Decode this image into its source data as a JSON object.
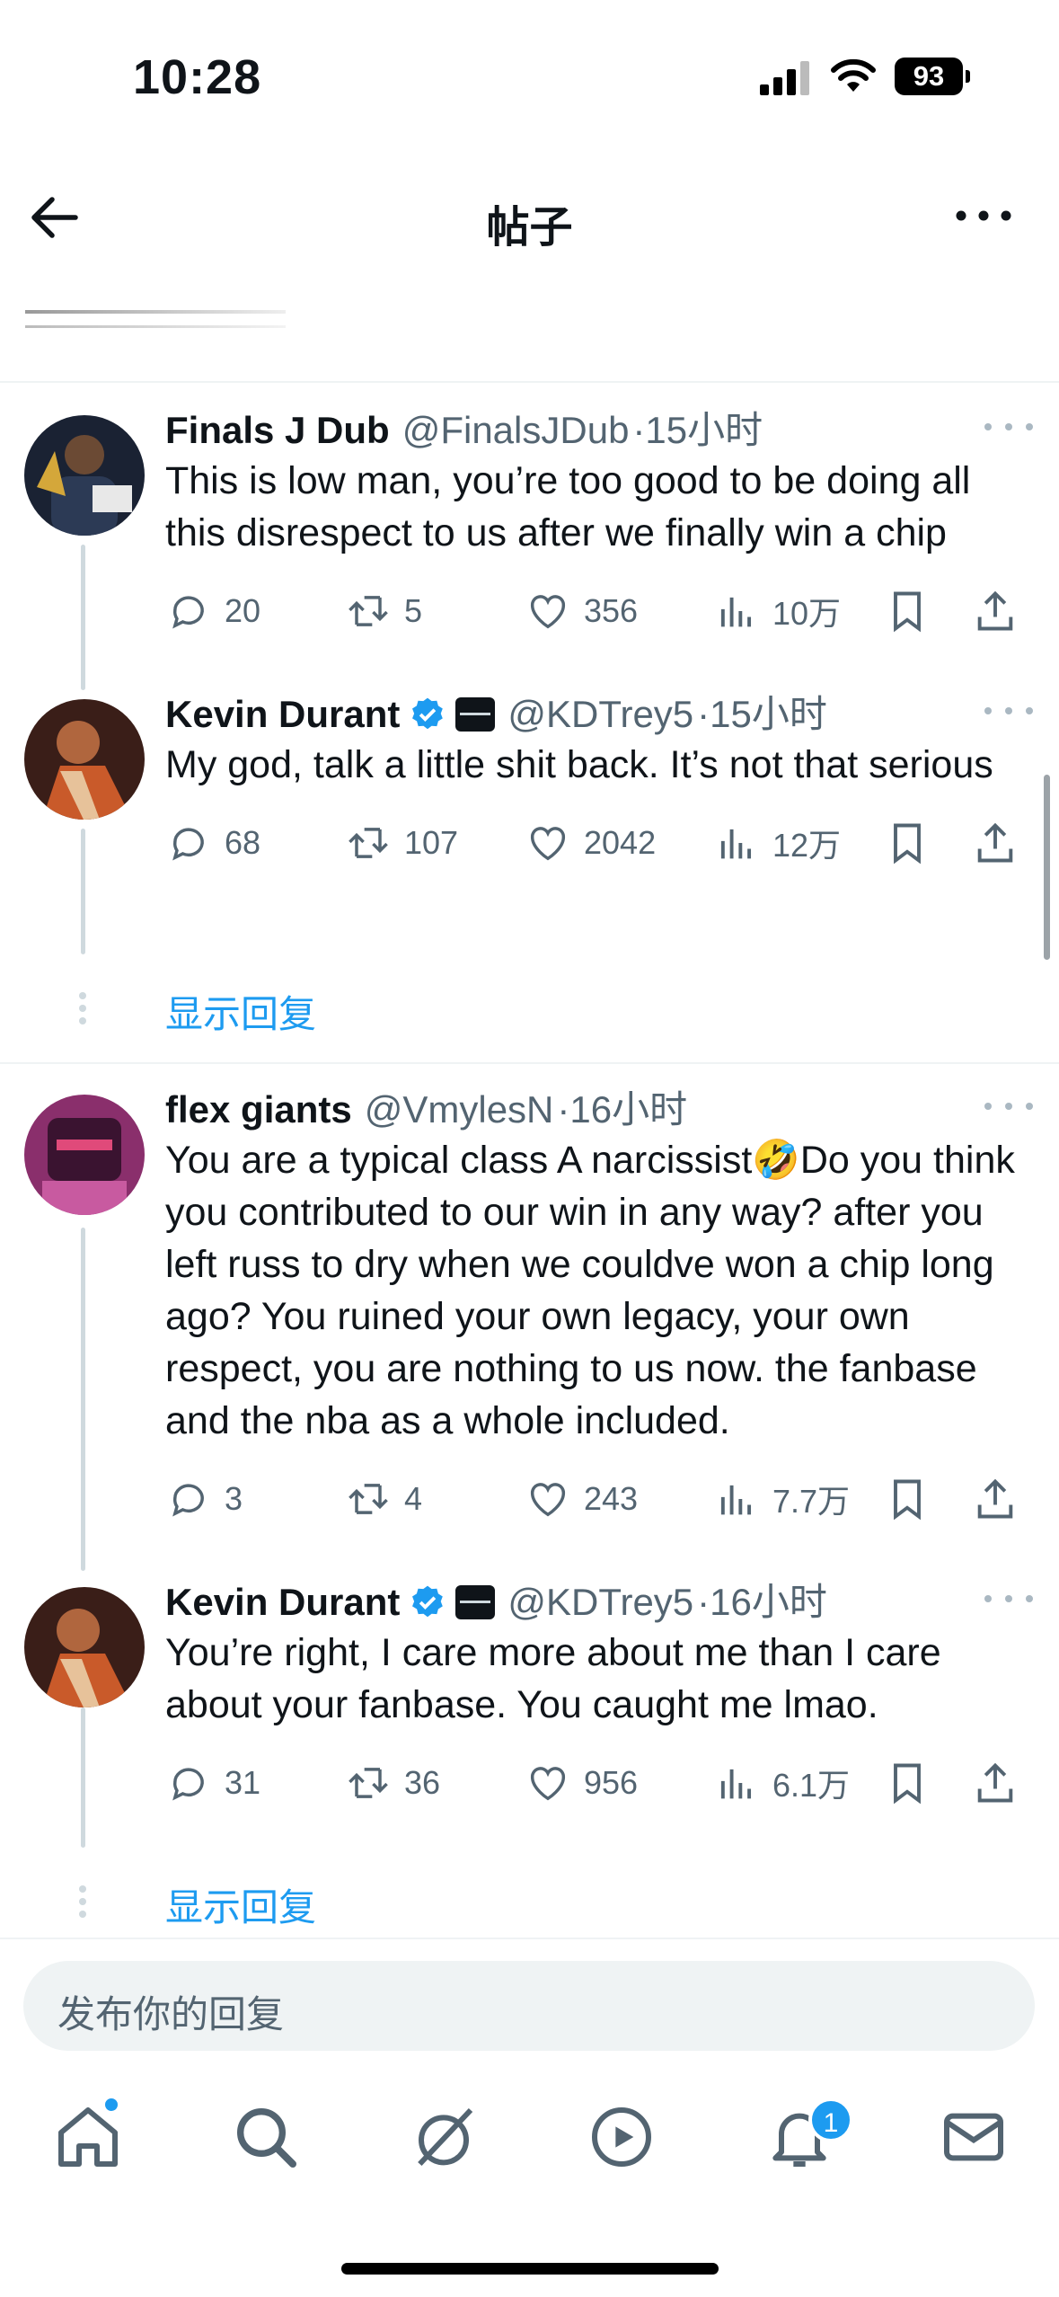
{
  "status": {
    "time": "10:28",
    "battery": "93"
  },
  "nav": {
    "title": "帖子",
    "back_icon": "arrow-left-icon",
    "more_icon": "more-horizontal-icon"
  },
  "tweets": [
    {
      "name": "Finals J Dub",
      "handle": "@FinalsJDub",
      "time": "·15小时",
      "verified": false,
      "text": "This is low man, you’re too good to be doing all this disrespect to us after we finally win a chip",
      "replies": "20",
      "retweets": "5",
      "likes": "356",
      "views": "10万"
    },
    {
      "name": "Kevin Durant",
      "handle": "@KDTrey5",
      "time": "·15小时",
      "verified": true,
      "text": "My god, talk a little shit back. It’s not that serious",
      "replies": "68",
      "retweets": "107",
      "likes": "2042",
      "views": "12万"
    },
    {
      "name": "flex giants",
      "handle": "@VmylesN",
      "time": "·16小时",
      "verified": false,
      "text": "You are a typical class A narcissist🤣Do you think you contributed to our win in any way? after you left russ to dry when we couldve won a chip long ago? You ruined your own legacy, your own respect, you are nothing to us now. the fanbase and the nba as a whole included.",
      "replies": "3",
      "retweets": "4",
      "likes": "243",
      "views": "7.7万"
    },
    {
      "name": "Kevin Durant",
      "handle": "@KDTrey5",
      "time": "·16小时",
      "verified": true,
      "text": "You’re right, I care more about me than I care about your fanbase. You caught me lmao.",
      "replies": "31",
      "retweets": "36",
      "likes": "956",
      "views": "6.1万"
    }
  ],
  "show_replies": "显示回复",
  "reply_placeholder": "发布你的回复",
  "tabs": [
    "home-icon",
    "search-icon",
    "grok-icon",
    "video-icon",
    "notifications-icon",
    "messages-icon"
  ],
  "notification_count": "1",
  "colors": {
    "accent": "#1d9bf0",
    "text": "#0f1419",
    "secondary": "#536471"
  }
}
